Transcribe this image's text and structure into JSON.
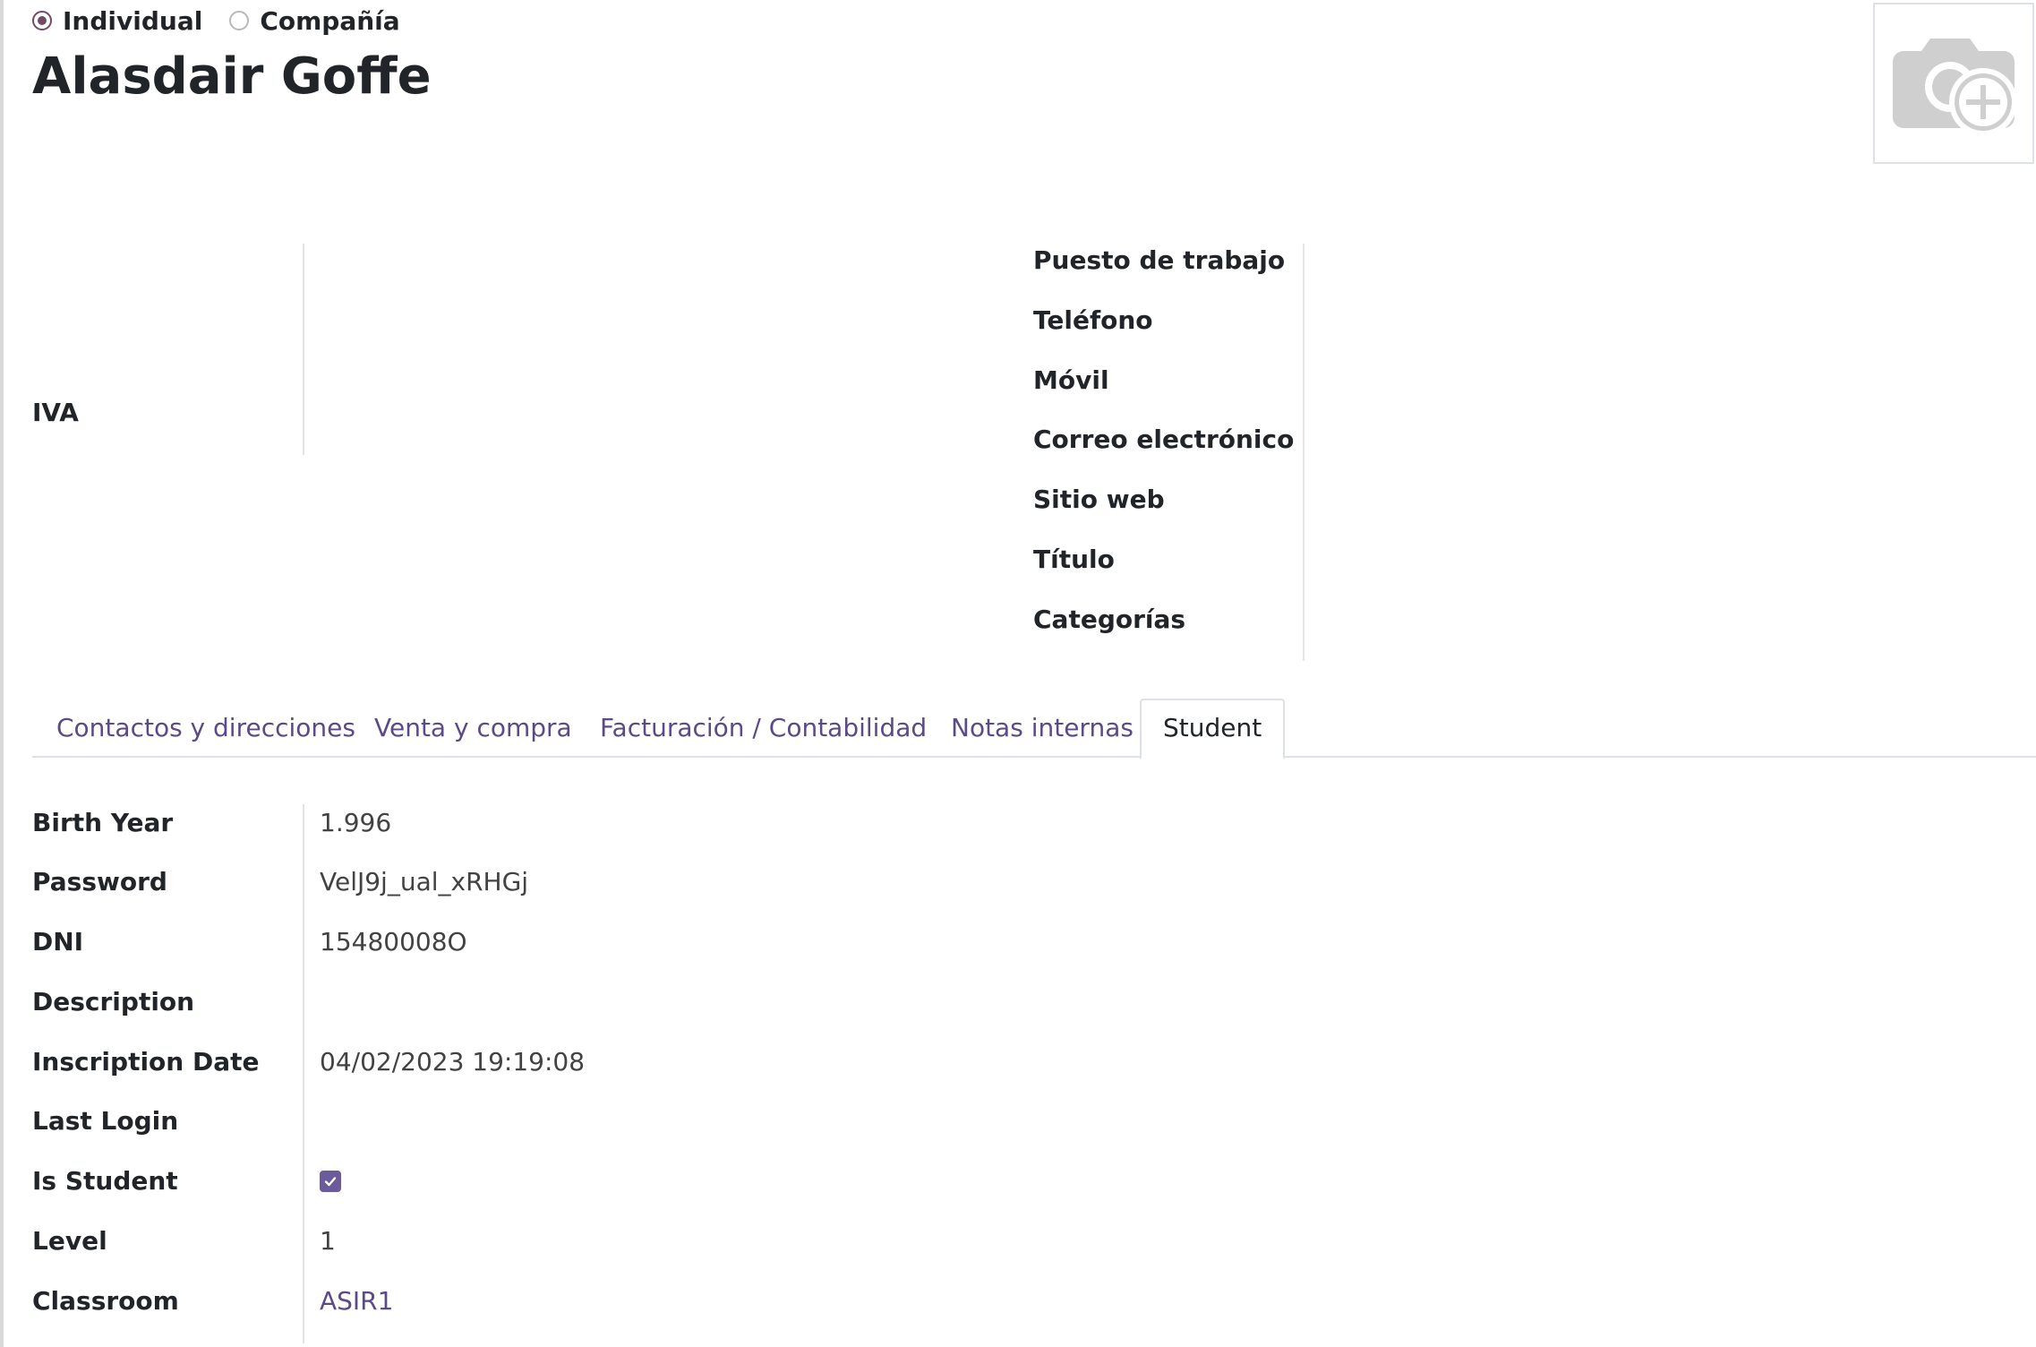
{
  "company_type": {
    "options": [
      {
        "label": "Individual",
        "selected": true
      },
      {
        "label": "Compañía",
        "selected": false
      }
    ]
  },
  "contact": {
    "name": "Alasdair Goffe"
  },
  "avatar": {
    "icon": "camera-plus-icon"
  },
  "left_group": {
    "vat_label": "IVA"
  },
  "right_group": {
    "labels": [
      "Puesto de trabajo",
      "Teléfono",
      "Móvil",
      "Correo electrónico",
      "Sitio web",
      "Título",
      "Categorías"
    ]
  },
  "tabs": [
    {
      "label": "Contactos y direcciones",
      "active": false
    },
    {
      "label": "Venta y compra",
      "active": false
    },
    {
      "label": "Facturación / Contabilidad",
      "active": false
    },
    {
      "label": "Notas internas",
      "active": false
    },
    {
      "label": "Student",
      "active": true
    }
  ],
  "student": {
    "birth_year": {
      "label": "Birth Year",
      "value": "1.996"
    },
    "password": {
      "label": "Password",
      "value": "VelJ9j_ual_xRHGj"
    },
    "dni": {
      "label": "DNI",
      "value": "15480008O"
    },
    "description": {
      "label": "Description",
      "value": ""
    },
    "inscription_date": {
      "label": "Inscription Date",
      "value": "04/02/2023 19:19:08"
    },
    "last_login": {
      "label": "Last Login",
      "value": ""
    },
    "is_student": {
      "label": "Is Student",
      "checked": true
    },
    "level": {
      "label": "Level",
      "value": "1"
    },
    "classroom": {
      "label": "Classroom",
      "value": "ASIR1"
    }
  },
  "colors": {
    "brand": "#714b67",
    "link": "#5b4a86",
    "checkbox": "#6b5b9a",
    "text": "#212529"
  }
}
